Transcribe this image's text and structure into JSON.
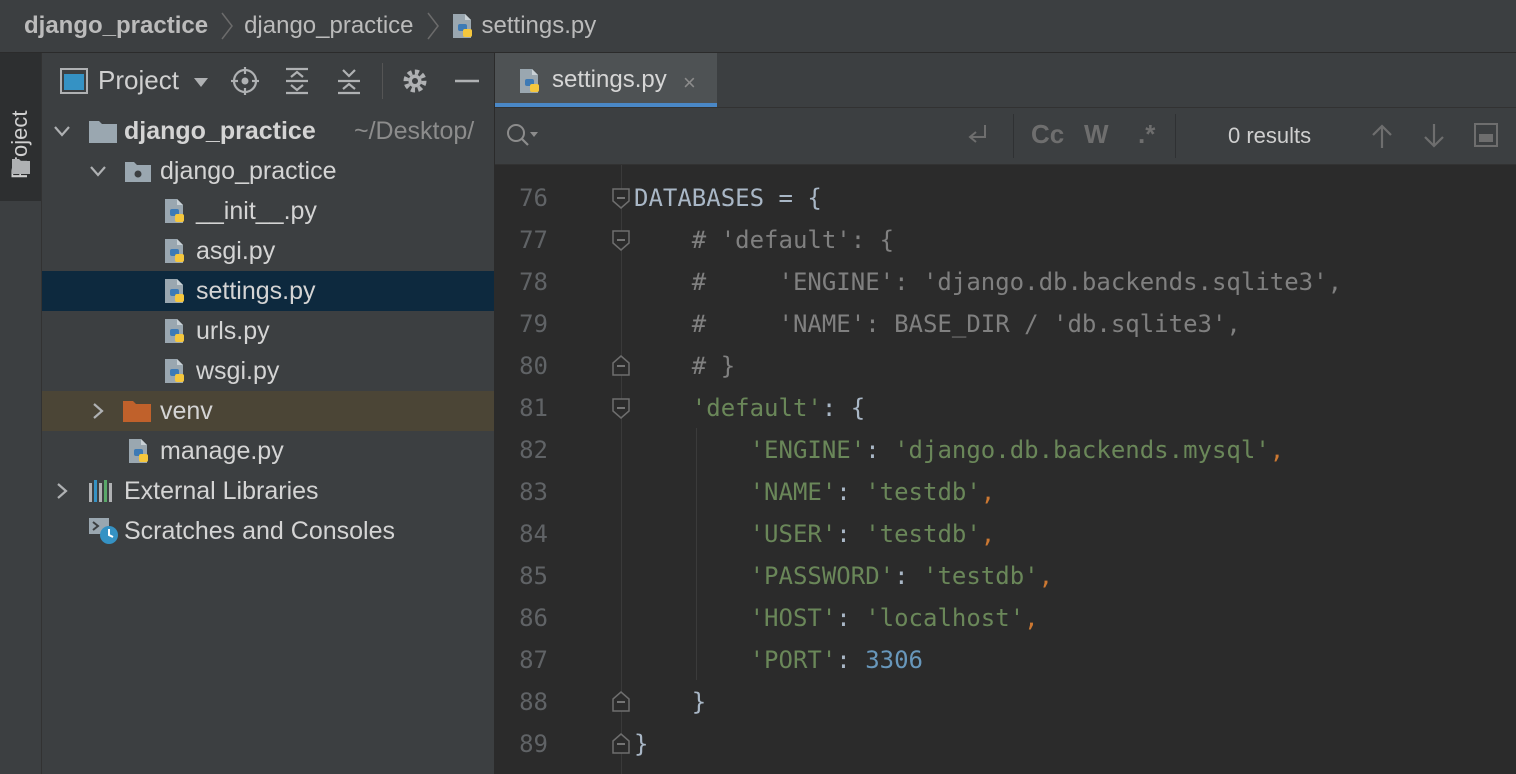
{
  "breadcrumb": {
    "items": [
      "django_practice",
      "django_practice",
      "settings.py"
    ]
  },
  "side_strip": {
    "project_tab": "Project"
  },
  "project_panel": {
    "title": "Project",
    "tree": [
      {
        "label": "django_practice",
        "path": "~/Desktop/",
        "expanded": true
      },
      {
        "label": "django_practice",
        "expanded": true
      },
      {
        "label": "__init__.py"
      },
      {
        "label": "asgi.py"
      },
      {
        "label": "settings.py",
        "selected": true
      },
      {
        "label": "urls.py"
      },
      {
        "label": "wsgi.py"
      },
      {
        "label": "venv",
        "expanded": false
      },
      {
        "label": "manage.py"
      },
      {
        "label": "External Libraries",
        "expanded": false
      },
      {
        "label": "Scratches and Consoles"
      }
    ]
  },
  "editor": {
    "tab": {
      "label": "settings.py",
      "close": "×"
    },
    "search": {
      "value": "",
      "placeholder": "",
      "match_case": "Cc",
      "words": "W",
      "regex": ".*",
      "results": "0 results"
    },
    "lines": [
      {
        "num": "76",
        "parts": [
          [
            "plain",
            "DATABASES = {"
          ]
        ]
      },
      {
        "num": "77",
        "parts": [
          [
            "comment",
            "    # 'default': {"
          ]
        ]
      },
      {
        "num": "78",
        "parts": [
          [
            "comment",
            "    #     'ENGINE': 'django.db.backends.sqlite3',"
          ]
        ]
      },
      {
        "num": "79",
        "parts": [
          [
            "comment",
            "    #     'NAME': BASE_DIR / 'db.sqlite3',"
          ]
        ]
      },
      {
        "num": "80",
        "parts": [
          [
            "comment",
            "    # }"
          ]
        ]
      },
      {
        "num": "81",
        "parts": [
          [
            "plain",
            "    "
          ],
          [
            "string",
            "'default'"
          ],
          [
            "plain",
            ": {"
          ]
        ]
      },
      {
        "num": "82",
        "parts": [
          [
            "plain",
            "        "
          ],
          [
            "string",
            "'ENGINE'"
          ],
          [
            "plain",
            ": "
          ],
          [
            "string",
            "'django.db.backends.mysql'"
          ],
          [
            "punct",
            ","
          ]
        ]
      },
      {
        "num": "83",
        "parts": [
          [
            "plain",
            "        "
          ],
          [
            "string",
            "'NAME'"
          ],
          [
            "plain",
            ": "
          ],
          [
            "string",
            "'testdb'"
          ],
          [
            "punct",
            ","
          ]
        ]
      },
      {
        "num": "84",
        "parts": [
          [
            "plain",
            "        "
          ],
          [
            "string",
            "'USER'"
          ],
          [
            "plain",
            ": "
          ],
          [
            "string",
            "'testdb'"
          ],
          [
            "punct",
            ","
          ]
        ]
      },
      {
        "num": "85",
        "parts": [
          [
            "plain",
            "        "
          ],
          [
            "string",
            "'PASSWORD'"
          ],
          [
            "plain",
            ": "
          ],
          [
            "string",
            "'testdb'"
          ],
          [
            "punct",
            ","
          ]
        ]
      },
      {
        "num": "86",
        "parts": [
          [
            "plain",
            "        "
          ],
          [
            "string",
            "'HOST'"
          ],
          [
            "plain",
            ": "
          ],
          [
            "string",
            "'localhost'"
          ],
          [
            "punct",
            ","
          ]
        ]
      },
      {
        "num": "87",
        "parts": [
          [
            "plain",
            "        "
          ],
          [
            "string",
            "'PORT'"
          ],
          [
            "plain",
            ": "
          ],
          [
            "num",
            "3306"
          ]
        ]
      },
      {
        "num": "88",
        "parts": [
          [
            "plain",
            "    }"
          ]
        ]
      },
      {
        "num": "89",
        "parts": [
          [
            "plain",
            "}"
          ]
        ]
      }
    ]
  },
  "colors": {
    "background": "#2b2b2b",
    "panel": "#3c3f41",
    "selection": "#0d293e",
    "excluded": "#4b4536",
    "accent": "#4a88c7",
    "string": "#6a8759",
    "comment": "#808080",
    "number": "#6897bb",
    "punctuation": "#cc7832",
    "folder_excluded": "#c0612b"
  }
}
